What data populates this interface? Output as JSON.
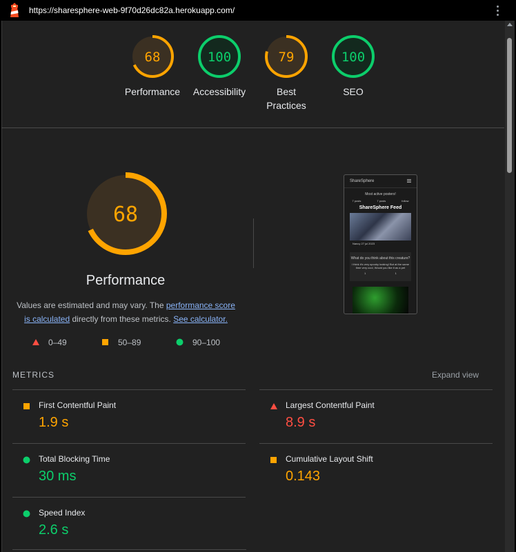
{
  "browser": {
    "url": "https://sharesphere-web-9f70d26dc82a.herokuapp.com/",
    "logo_icon": "lighthouse-icon",
    "menu_icon": "kebab-menu-icon"
  },
  "colors": {
    "orange": "#ffa400",
    "green": "#0cce6b",
    "red": "#ff4e42",
    "background": "#212121"
  },
  "summary_gauges": [
    {
      "score": 68,
      "label_lines": [
        "Performance"
      ],
      "status": "average"
    },
    {
      "score": 100,
      "label_lines": [
        "Accessibility"
      ],
      "status": "pass"
    },
    {
      "score": 79,
      "label_lines": [
        "Best",
        "Practices"
      ],
      "status": "average"
    },
    {
      "score": 100,
      "label_lines": [
        "SEO"
      ],
      "status": "pass"
    }
  ],
  "performance": {
    "score": 68,
    "title": "Performance",
    "desc_prefix": "Values are estimated and may vary. The ",
    "link_score": "performance score is calculated",
    "desc_middle": " directly from these metrics. ",
    "link_calc": "See calculator."
  },
  "legend": [
    {
      "shape": "triangle",
      "range": "0–49"
    },
    {
      "shape": "square",
      "range": "50–89"
    },
    {
      "shape": "circle",
      "range": "90–100"
    }
  ],
  "screenshot_thumbnail": {
    "app_name": "ShareSphere",
    "heading": "Most active posters!",
    "user1": "7 posts",
    "user2": "7 posts",
    "user3": "follow",
    "feed_title": "ShareSphere Feed",
    "author": "Nancy",
    "date": "27 jul 2023",
    "post_title": "What do you think about this creature?",
    "post_body": "I think it's very spooky looking! But at the same time very cool, Would you like it as a pet",
    "likes": "1",
    "comments": "1"
  },
  "metrics_section": {
    "heading": "METRICS",
    "expand_label": "Expand view"
  },
  "metrics": [
    {
      "name": "First Contentful Paint",
      "value": "1.9 s",
      "status": "average"
    },
    {
      "name": "Largest Contentful Paint",
      "value": "8.9 s",
      "status": "fail"
    },
    {
      "name": "Total Blocking Time",
      "value": "30 ms",
      "status": "pass"
    },
    {
      "name": "Cumulative Layout Shift",
      "value": "0.143",
      "status": "average"
    },
    {
      "name": "Speed Index",
      "value": "2.6 s",
      "status": "pass"
    }
  ]
}
